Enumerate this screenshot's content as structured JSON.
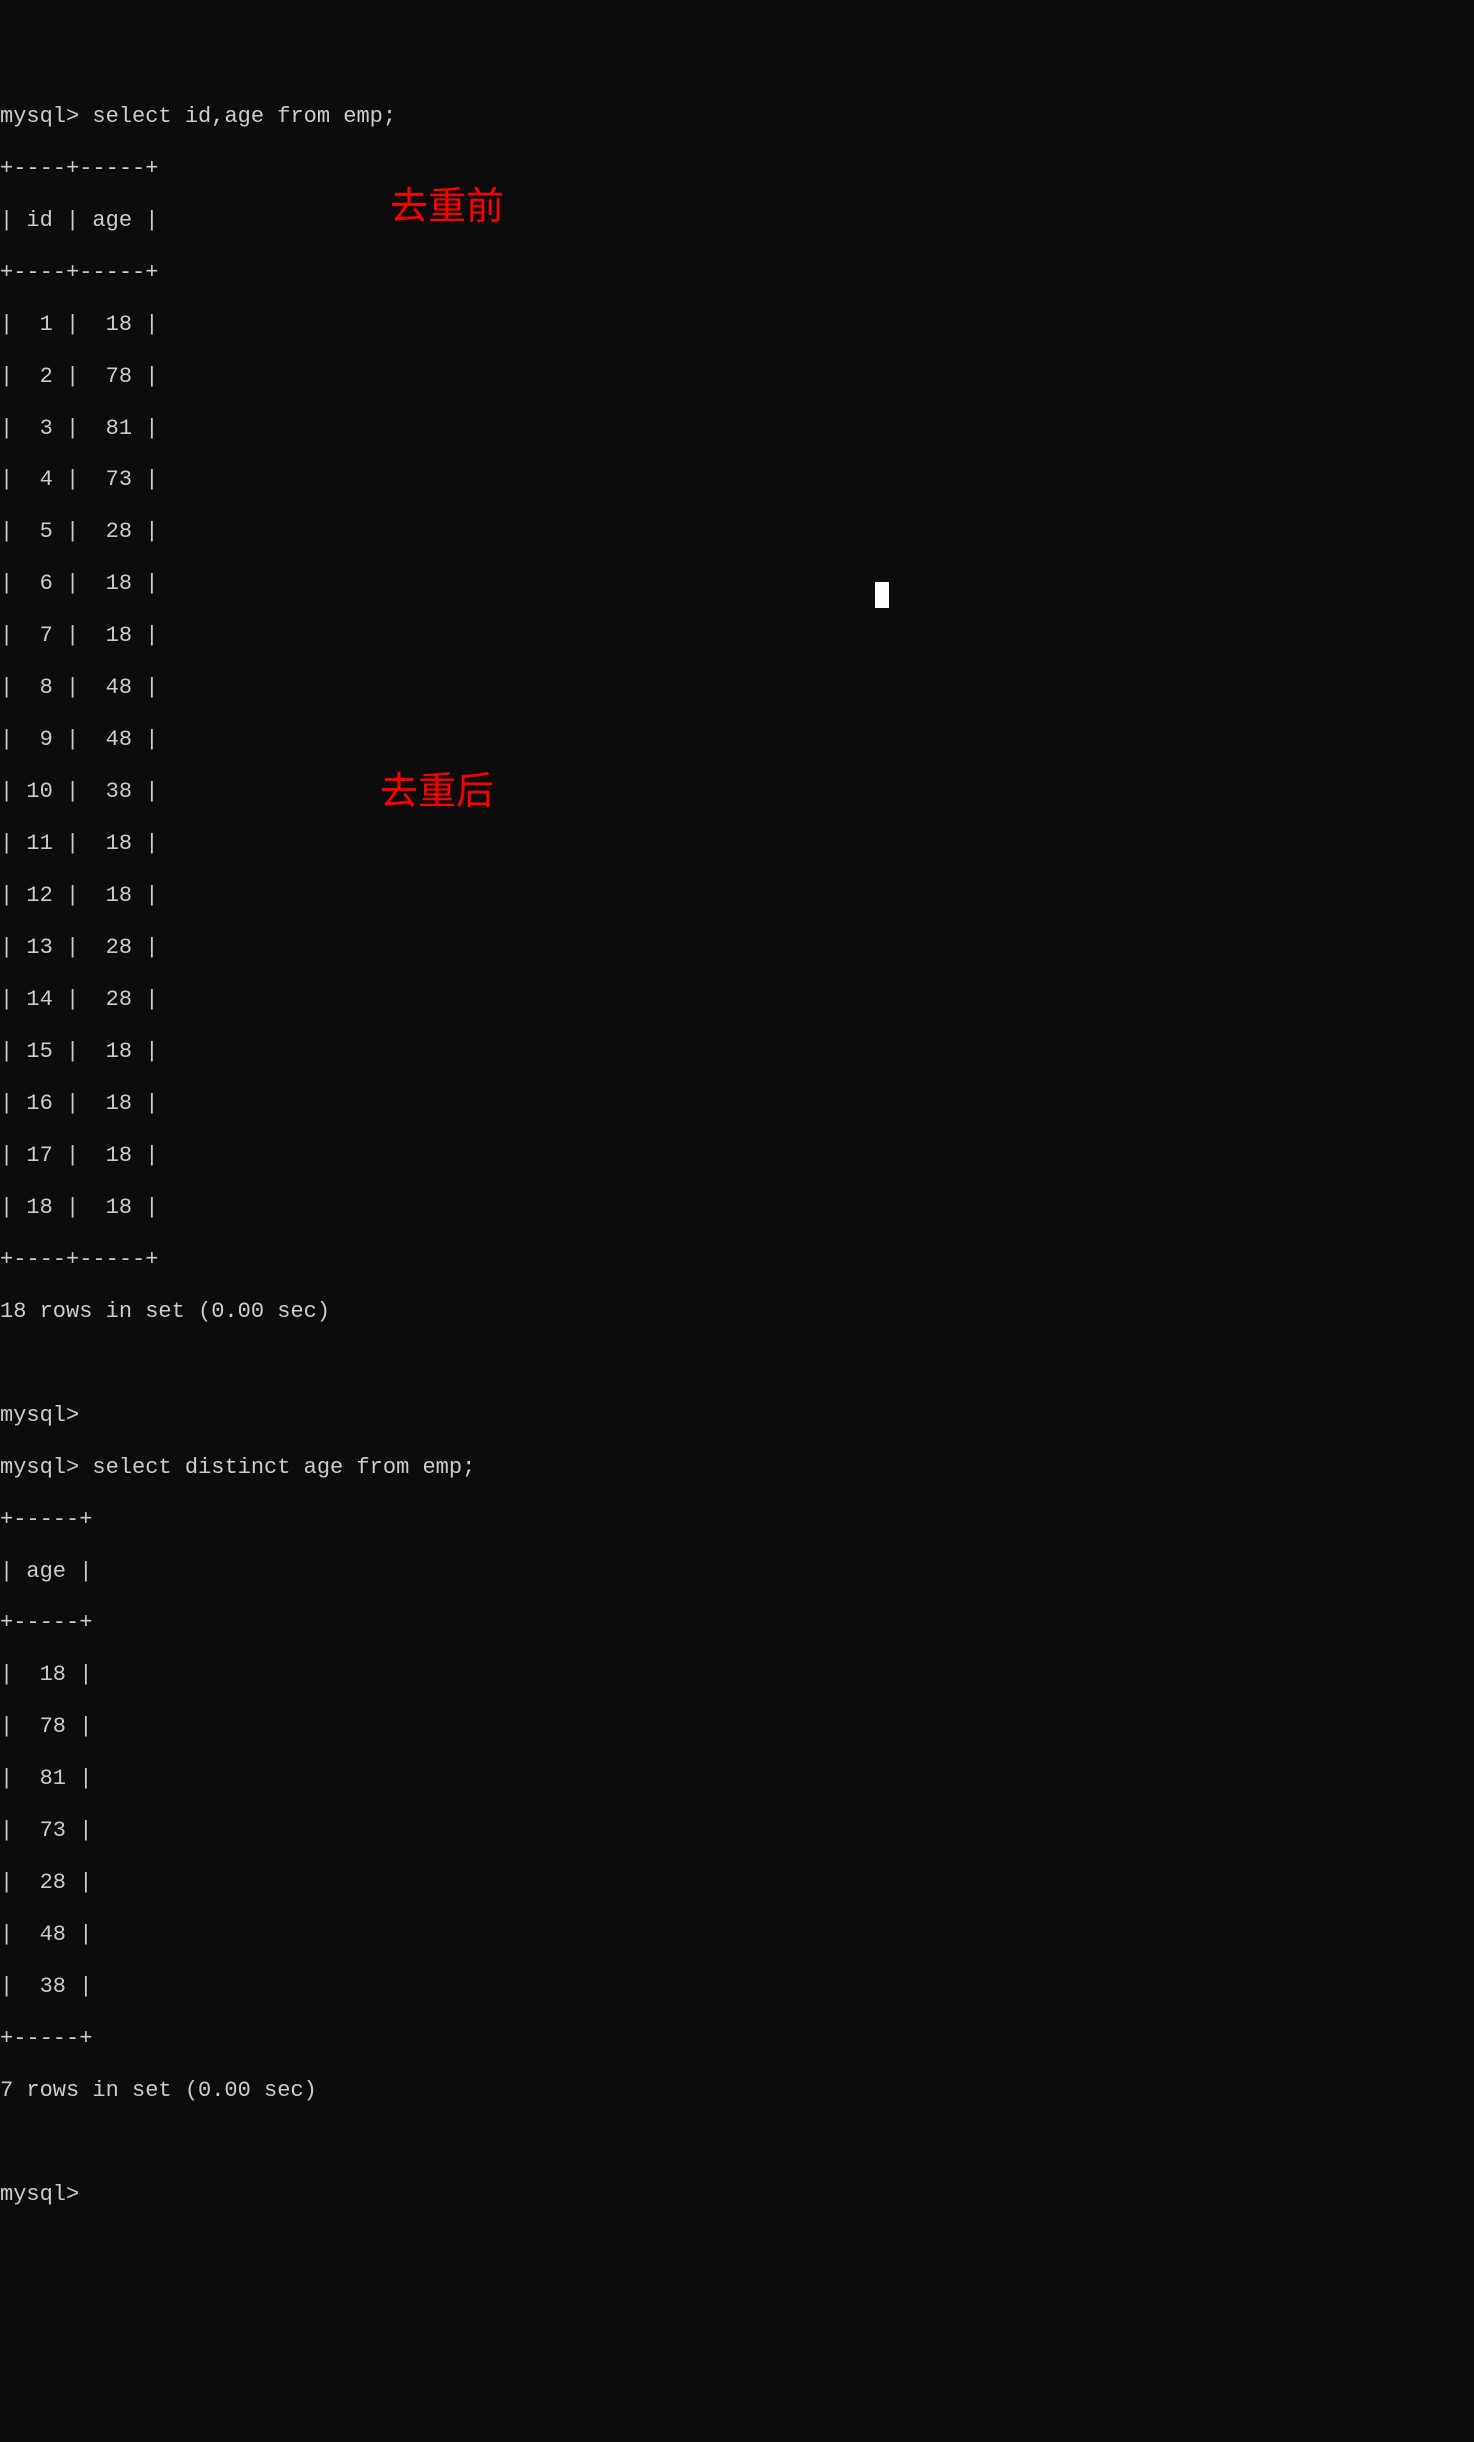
{
  "prompts": {
    "mysql": "mysql>",
    "query1": " select id,age from emp;",
    "query2": " select distinct age from emp;"
  },
  "table1": {
    "border_top": "+----+-----+",
    "header": "| id | age |",
    "border_mid": "+----+-----+",
    "rows": [
      "|  1 |  18 |",
      "|  2 |  78 |",
      "|  3 |  81 |",
      "|  4 |  73 |",
      "|  5 |  28 |",
      "|  6 |  18 |",
      "|  7 |  18 |",
      "|  8 |  48 |",
      "|  9 |  48 |",
      "| 10 |  38 |",
      "| 11 |  18 |",
      "| 12 |  18 |",
      "| 13 |  28 |",
      "| 14 |  28 |",
      "| 15 |  18 |",
      "| 16 |  18 |",
      "| 17 |  18 |",
      "| 18 |  18 |"
    ],
    "border_bot": "+----+-----+",
    "summary": "18 rows in set (0.00 sec)"
  },
  "table2": {
    "border_top": "+-----+",
    "header": "| age |",
    "border_mid": "+-----+",
    "rows": [
      "|  18 |",
      "|  78 |",
      "|  81 |",
      "|  73 |",
      "|  28 |",
      "|  48 |",
      "|  38 |"
    ],
    "border_bot": "+-----+",
    "summary": "7 rows in set (0.00 sec)"
  },
  "annotations": {
    "before": "去重前",
    "after": "去重后"
  },
  "empty": ""
}
